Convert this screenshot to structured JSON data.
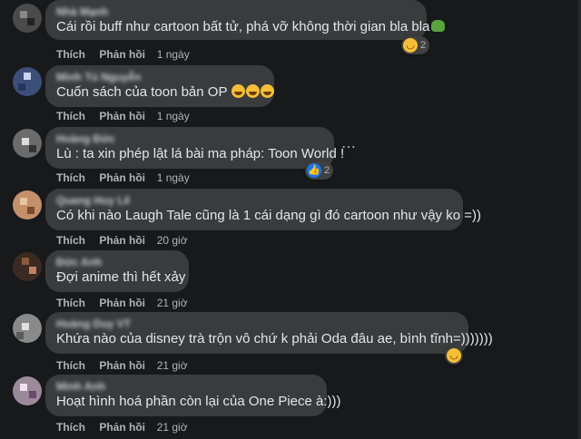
{
  "actions": {
    "like": "Thích",
    "reply": "Phản hồi"
  },
  "comments": [
    {
      "author": "Nhà Mạnh",
      "text": "Cái rồi buff như cartoon bất tử, phá vỡ không thời gian bla bla",
      "time": "1 ngày",
      "reaction_count": "2"
    },
    {
      "author": "Minh Tú Nguyễn",
      "text": "Cuốn sách của toon bản OP",
      "time": "1 ngày"
    },
    {
      "author": "Hoàng Đức",
      "text": "Lù : ta xin phép lật lá bài ma pháp: Toon World !",
      "time": "1 ngày",
      "reaction_count": "2"
    },
    {
      "author": "Quang Huy Lê",
      "text": "Có khi nào Laugh Tale cũng là 1 cái dạng gì đó cartoon như vậy ko =))",
      "time": "20 giờ"
    },
    {
      "author": "Đức Anh",
      "text": "Đợi anime thì hết xảy",
      "time": "21 giờ"
    },
    {
      "author": "Hoàng Duy VT",
      "text": "Khứa nào của disney trà trộn vô chứ k phải Oda đâu ae, bình tĩnh=)))))))",
      "time": "21 giờ"
    },
    {
      "author": "Minh Anh",
      "text": "Hoạt hình hoá phần còn lại của One Piece à:)))",
      "time": "21 giờ"
    }
  ],
  "colors": {
    "background": "#18191a",
    "bubble": "#3a3b3c",
    "secondary_text": "#b0b3b8",
    "like_blue": "#1877f2",
    "haha_yellow": "#f7c034"
  }
}
